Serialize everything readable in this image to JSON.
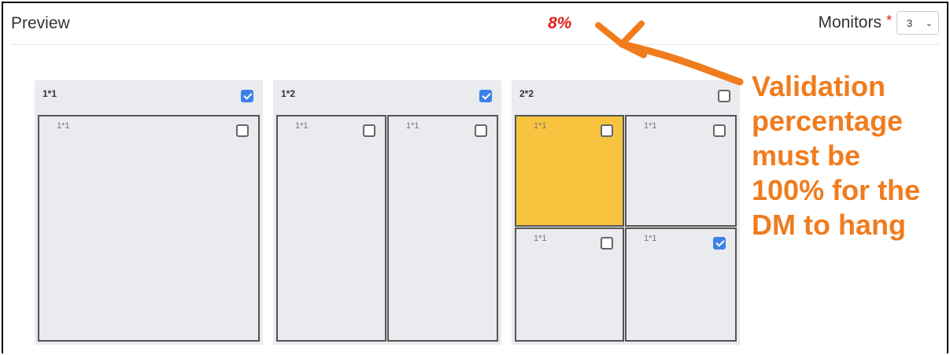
{
  "header": {
    "title": "Preview",
    "validation_percentage": "8%",
    "monitors_label": "Monitors",
    "required_marker": "*",
    "monitors_value": "3"
  },
  "layouts": [
    {
      "name": "1*1",
      "checked": true,
      "screens": [
        {
          "name": "1*1",
          "checked": false,
          "active": false
        }
      ]
    },
    {
      "name": "1*2",
      "checked": true,
      "screens": [
        {
          "name": "1*1",
          "checked": false,
          "active": false
        },
        {
          "name": "1*1",
          "checked": false,
          "active": false
        }
      ]
    },
    {
      "name": "2*2",
      "checked": false,
      "screens": [
        {
          "name": "1*1",
          "checked": false,
          "active": true
        },
        {
          "name": "1*1",
          "checked": false,
          "active": false
        },
        {
          "name": "1*1",
          "checked": false,
          "active": false
        },
        {
          "name": "1*1",
          "checked": true,
          "active": false
        }
      ]
    }
  ],
  "annotation": {
    "text": "Validation\npercentage\nmust be\n100% for the\nDM to hang",
    "color": "#f07c1e"
  },
  "colors": {
    "percentage": "#e0201a",
    "checkbox_checked": "#3b82e8",
    "active_screen": "#f8c440",
    "panel_bg": "#e9ebee"
  }
}
